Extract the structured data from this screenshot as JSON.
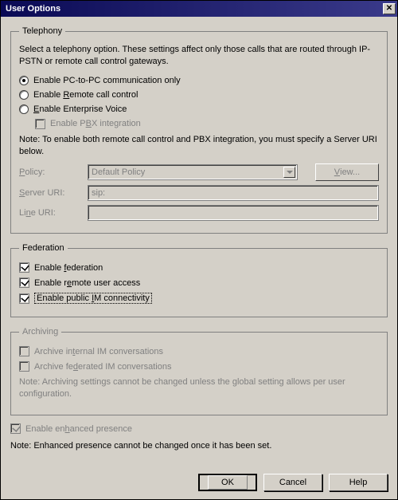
{
  "window": {
    "title": "User Options"
  },
  "telephony": {
    "legend": "Telephony",
    "description": "Select a telephony option. These settings affect only those calls that are routed through IP-PSTN or remote call control gateways.",
    "radios": {
      "pc2pc": "Enable PC-to-PC communication only",
      "remote_pre": "Enable ",
      "remote_u": "R",
      "remote_post": "emote call control",
      "ev_u": "E",
      "ev_post": "nable Enterprise Voice"
    },
    "pbx": {
      "pre": "Enable P",
      "u": "B",
      "post": "X integration"
    },
    "note": "Note: To enable both remote call control and PBX integration, you must specify a Server URI below.",
    "policy": {
      "label_u": "P",
      "label_post": "olicy:",
      "value": "Default Policy",
      "view_u": "V",
      "view_post": "iew..."
    },
    "server_uri": {
      "label_u": "S",
      "label_post": "erver URI:",
      "value": "sip:"
    },
    "line_uri": {
      "label_pre": "Li",
      "label_u": "n",
      "label_post": "e URI:",
      "value": ""
    }
  },
  "federation": {
    "legend": "Federation",
    "items": {
      "fed_pre": "Enable ",
      "fed_u": "f",
      "fed_post": "ederation",
      "remote_pre": "Enable r",
      "remote_u": "e",
      "remote_post": "mote user access",
      "public_pre": "Enable public ",
      "public_u": "I",
      "public_post": "M connectivity"
    }
  },
  "archiving": {
    "legend": "Archiving",
    "internal_pre": "Archive in",
    "internal_u": "t",
    "internal_post": "ernal IM conversations",
    "federated_pre": "Archive fe",
    "federated_u": "d",
    "federated_post": "erated IM conversations",
    "note": "Note: Archiving settings cannot be changed unless the global setting allows per user configuration."
  },
  "enhanced": {
    "pre": "Enable en",
    "u": "h",
    "post": "anced presence",
    "note": "Note: Enhanced presence cannot be changed once it has been set."
  },
  "buttons": {
    "ok": "OK",
    "cancel": "Cancel",
    "help": "Help"
  }
}
